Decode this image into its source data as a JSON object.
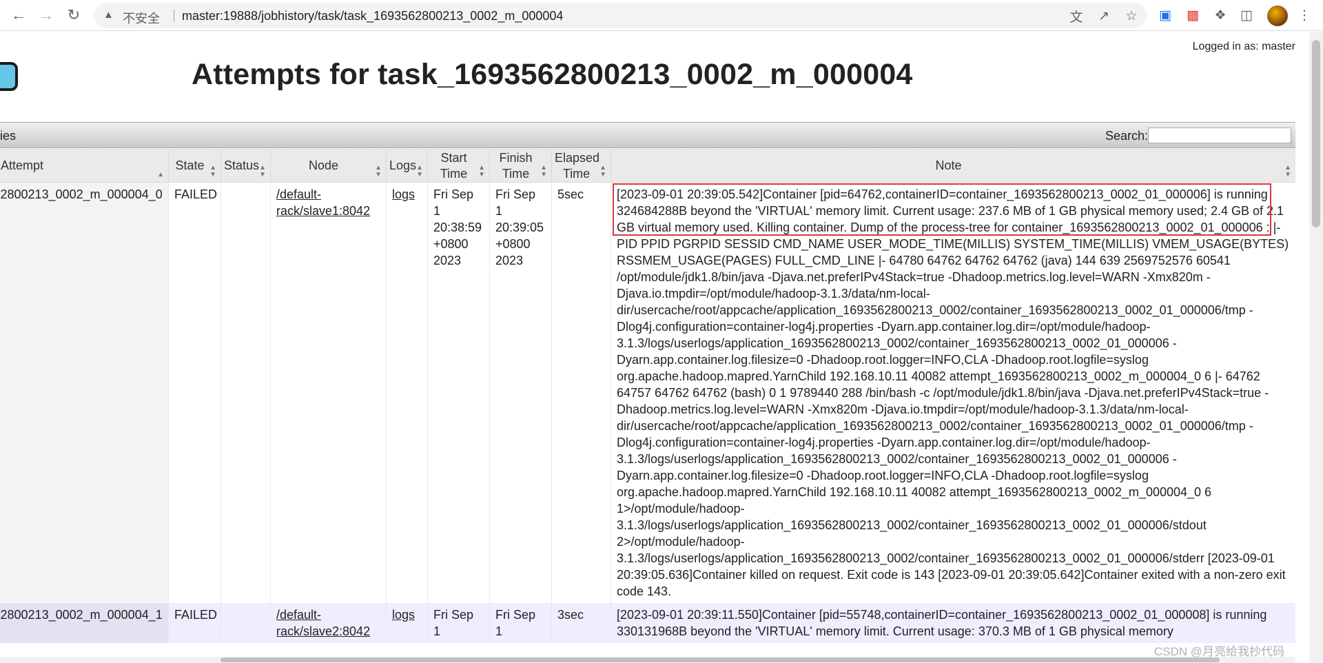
{
  "browser": {
    "insecure_label": "不安全",
    "url": "master:19888/jobhistory/task/task_1693562800213_0002_m_000004"
  },
  "header": {
    "logged_in": "Logged in as: master",
    "title": "Attempts for task_1693562800213_0002_m_000004"
  },
  "table_bar": {
    "label": "ies",
    "search_label": "Search:",
    "search_value": ""
  },
  "table": {
    "columns": [
      {
        "label": "Attempt"
      },
      {
        "label": "State"
      },
      {
        "label": "Status"
      },
      {
        "label": "Node"
      },
      {
        "label": "Logs"
      },
      {
        "label": "Start Time"
      },
      {
        "label": "Finish Time"
      },
      {
        "label": "Elapsed Time"
      },
      {
        "label": "Note"
      }
    ],
    "rows": [
      {
        "attempt": "2800213_0002_m_000004_0",
        "state": "FAILED",
        "status": "",
        "node": "/default-rack/slave1:8042",
        "logs": "logs",
        "start_time": "Fri Sep 1 20:38:59 +0800 2023",
        "finish_time": "Fri Sep 1 20:39:05 +0800 2023",
        "elapsed": "5sec",
        "note": "[2023-09-01 20:39:05.542]Container [pid=64762,containerID=container_1693562800213_0002_01_000006] is running 324684288B beyond the 'VIRTUAL' memory limit. Current usage: 237.6 MB of 1 GB physical memory used; 2.4 GB of 2.1 GB virtual memory used. Killing container. Dump of the process-tree for container_1693562800213_0002_01_000006 : |- PID PPID PGRPID SESSID CMD_NAME USER_MODE_TIME(MILLIS) SYSTEM_TIME(MILLIS) VMEM_USAGE(BYTES) RSSMEM_USAGE(PAGES) FULL_CMD_LINE |- 64780 64762 64762 64762 (java) 144 639 2569752576 60541 /opt/module/jdk1.8/bin/java -Djava.net.preferIPv4Stack=true -Dhadoop.metrics.log.level=WARN -Xmx820m -Djava.io.tmpdir=/opt/module/hadoop-3.1.3/data/nm-local-dir/usercache/root/appcache/application_1693562800213_0002/container_1693562800213_0002_01_000006/tmp -Dlog4j.configuration=container-log4j.properties -Dyarn.app.container.log.dir=/opt/module/hadoop-3.1.3/logs/userlogs/application_1693562800213_0002/container_1693562800213_0002_01_000006 -Dyarn.app.container.log.filesize=0 -Dhadoop.root.logger=INFO,CLA -Dhadoop.root.logfile=syslog org.apache.hadoop.mapred.YarnChild 192.168.10.11 40082 attempt_1693562800213_0002_m_000004_0 6 |- 64762 64757 64762 64762 (bash) 0 1 9789440 288 /bin/bash -c /opt/module/jdk1.8/bin/java -Djava.net.preferIPv4Stack=true -Dhadoop.metrics.log.level=WARN -Xmx820m -Djava.io.tmpdir=/opt/module/hadoop-3.1.3/data/nm-local-dir/usercache/root/appcache/application_1693562800213_0002/container_1693562800213_0002_01_000006/tmp -Dlog4j.configuration=container-log4j.properties -Dyarn.app.container.log.dir=/opt/module/hadoop-3.1.3/logs/userlogs/application_1693562800213_0002/container_1693562800213_0002_01_000006 -Dyarn.app.container.log.filesize=0 -Dhadoop.root.logger=INFO,CLA -Dhadoop.root.logfile=syslog org.apache.hadoop.mapred.YarnChild 192.168.10.11 40082 attempt_1693562800213_0002_m_000004_0 6 1>/opt/module/hadoop-3.1.3/logs/userlogs/application_1693562800213_0002/container_1693562800213_0002_01_000006/stdout 2>/opt/module/hadoop-3.1.3/logs/userlogs/application_1693562800213_0002/container_1693562800213_0002_01_000006/stderr [2023-09-01 20:39:05.636]Container killed on request. Exit code is 143 [2023-09-01 20:39:05.642]Container exited with a non-zero exit code 143."
      },
      {
        "attempt": "2800213_0002_m_000004_1",
        "state": "FAILED",
        "status": "",
        "node": "/default-rack/slave2:8042",
        "logs": "logs",
        "start_time": "Fri Sep 1",
        "finish_time": "Fri Sep 1",
        "elapsed": "3sec",
        "note": "[2023-09-01 20:39:11.550]Container [pid=55748,containerID=container_1693562800213_0002_01_000008] is running 330131968B beyond the 'VIRTUAL' memory limit. Current usage: 370.3 MB of 1 GB physical memory"
      }
    ]
  },
  "watermark": "CSDN @月亮给我抄代码",
  "colors": {
    "highlight_box": "#d9363e",
    "header_bg": "#eaeaea",
    "even_row_bg": "#eeeeff"
  }
}
